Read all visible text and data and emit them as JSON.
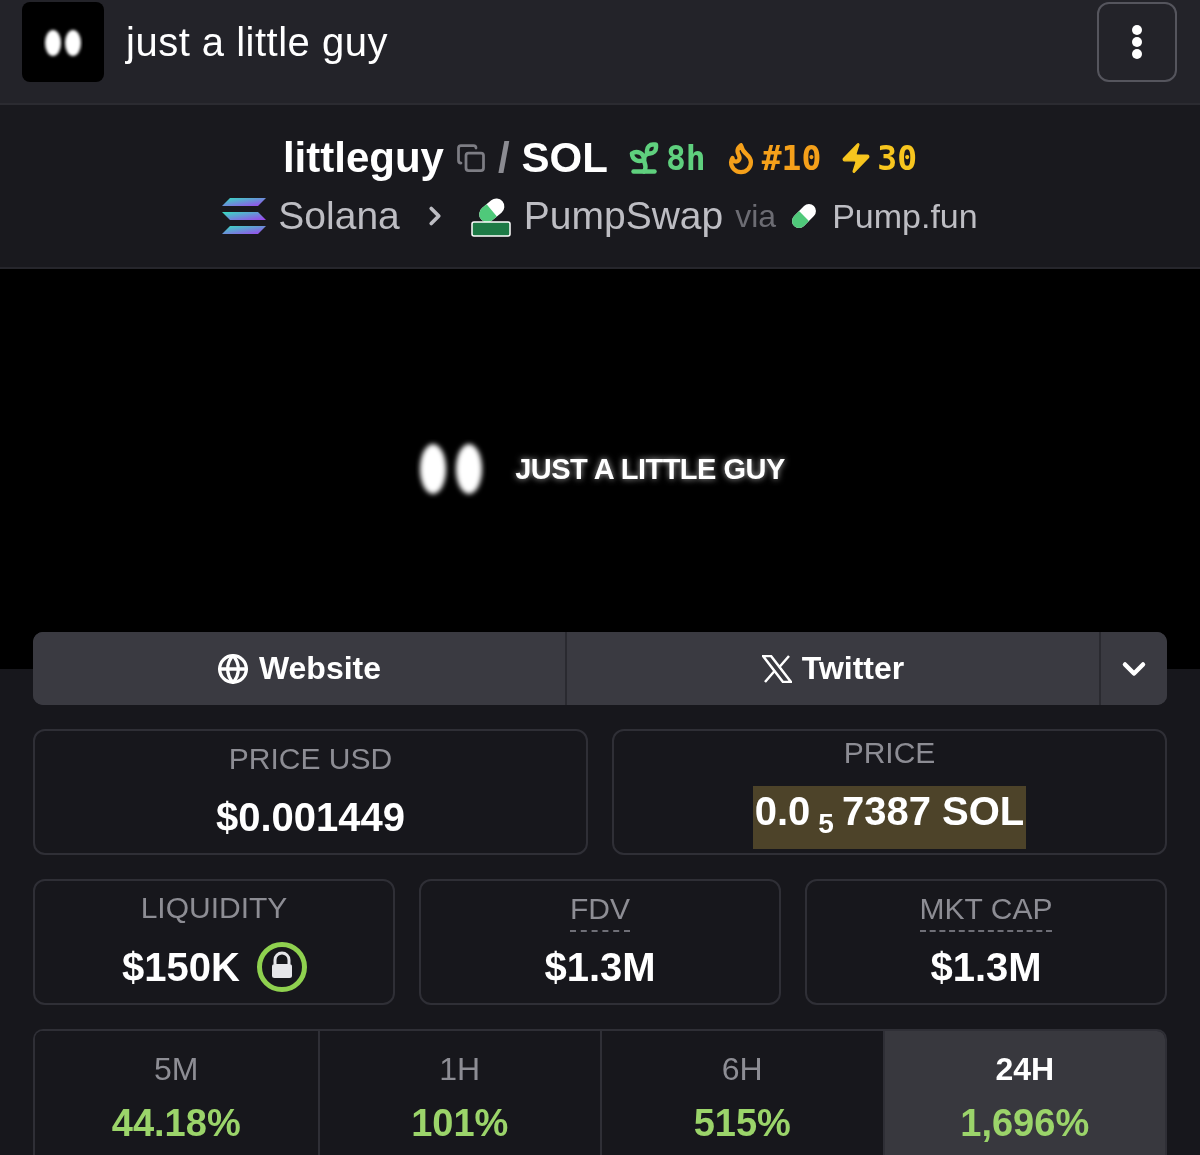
{
  "header": {
    "title": "just a little guy"
  },
  "pair": {
    "base": "littleguy",
    "separator": "/",
    "quote": "SOL",
    "badges": [
      {
        "kind": "age",
        "text": "8h",
        "color": "#5fd07e"
      },
      {
        "kind": "trending",
        "text": "#10",
        "color": "#f5a01a"
      },
      {
        "kind": "boost",
        "text": "30",
        "color": "#f7c51e"
      }
    ]
  },
  "route": {
    "chain": "Solana",
    "dex": "PumpSwap",
    "via": "via",
    "launchpad": "Pump.fun"
  },
  "banner": {
    "text": "JUST A LITTLE GUY"
  },
  "links": [
    {
      "kind": "website",
      "label": "Website"
    },
    {
      "kind": "twitter",
      "label": "Twitter"
    }
  ],
  "price_usd": {
    "label": "PRICE USD",
    "value": "$0.001449"
  },
  "price": {
    "label": "PRICE",
    "value": "0.0$_{5}$7387 SOL",
    "highlighted": true
  },
  "stats": [
    {
      "label": "LIQUIDITY",
      "value": "$150K",
      "locked": true,
      "hint": false
    },
    {
      "label": "FDV",
      "value": "$1.3M",
      "locked": false,
      "hint": true
    },
    {
      "label": "MKT CAP",
      "value": "$1.3M",
      "locked": false,
      "hint": true
    }
  ],
  "changes": [
    {
      "period": "5M",
      "value": "44.18%",
      "selected": false
    },
    {
      "period": "1H",
      "value": "101%",
      "selected": false
    },
    {
      "period": "6H",
      "value": "515%",
      "selected": false
    },
    {
      "period": "24H",
      "value": "1,696%",
      "selected": true
    }
  ]
}
